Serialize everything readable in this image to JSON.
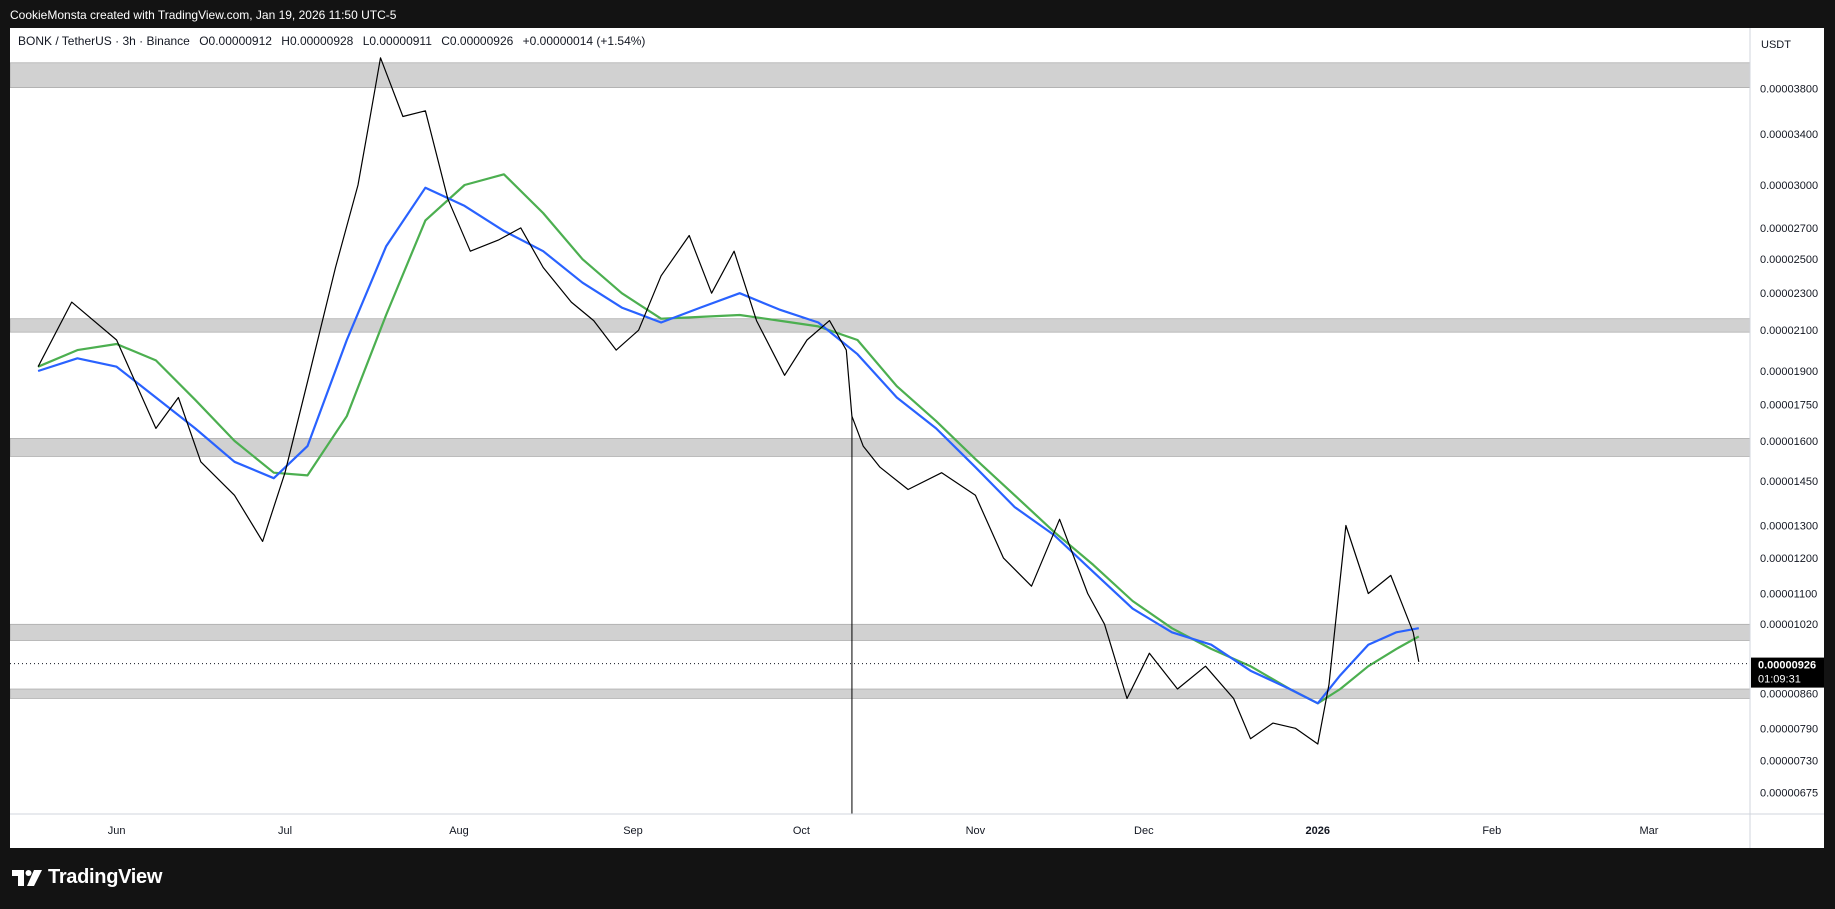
{
  "header": {
    "attribution": "CookieMonsta created with TradingView.com, Jan 19, 2026 11:50 UTC-5"
  },
  "brand": {
    "logo_text": "TradingView"
  },
  "chart_data": {
    "type": "line",
    "symbol_line": "BONK / TetherUS · 3h · Binance",
    "ohlc": {
      "open": "O0.00000912",
      "high": "H0.00000928",
      "low": "L0.00000911",
      "close": "C0.00000926",
      "change": "+0.00000014 (+1.54%)"
    },
    "currency": "USDT",
    "y_scale": "log",
    "y_ticks": [
      "0.00003800",
      "0.00003400",
      "0.00003000",
      "0.00002700",
      "0.00002500",
      "0.00002300",
      "0.00002100",
      "0.00001900",
      "0.00001750",
      "0.00001600",
      "0.00001450",
      "0.00001300",
      "0.00001200",
      "0.00001100",
      "0.00001020",
      "0.00000860",
      "0.00000790",
      "0.00000730",
      "0.00000675"
    ],
    "x_ticks": [
      "Jun",
      "Jul",
      "Aug",
      "Sep",
      "Oct",
      "Nov",
      "Dec",
      "2026",
      "Feb",
      "Mar"
    ],
    "current_price": "0.00000926",
    "countdown": "01:09:31",
    "zones": [
      {
        "low": 3.81e-05,
        "high": 4.05e-05
      },
      {
        "low": 2.09e-05,
        "high": 2.16e-05
      },
      {
        "low": 1.54e-05,
        "high": 1.61e-05
      },
      {
        "low": 9.8e-06,
        "high": 1.02e-05
      },
      {
        "low": 8.5e-06,
        "high": 8.7e-06
      }
    ],
    "series": [
      {
        "color": "#000000",
        "x": [
          "May 18",
          "May 24",
          "Jun 1",
          "Jun 8",
          "Jun 12",
          "Jun 16",
          "Jun 22",
          "Jun 27",
          "Jul 1",
          "Jul 5",
          "Jul 10",
          "Jul 14",
          "Jul 16",
          "Jul 18",
          "Jul 22",
          "Jul 26",
          "Jul 30",
          "Aug 3",
          "Aug 8",
          "Aug 12",
          "Aug 16",
          "Aug 21",
          "Aug 25",
          "Aug 29",
          "Sep 2",
          "Sep 6",
          "Sep 11",
          "Sep 15",
          "Sep 19",
          "Sep 23",
          "Sep 28",
          "Oct 2",
          "Oct 6",
          "Oct 9",
          "Oct 10",
          "Oct 12",
          "Oct 15",
          "Oct 20",
          "Oct 26",
          "Nov 1",
          "Nov 6",
          "Nov 11",
          "Nov 16",
          "Nov 21",
          "Nov 24",
          "Nov 28",
          "Dec 2",
          "Dec 7",
          "Dec 12",
          "Dec 17",
          "Dec 20",
          "Dec 24",
          "Dec 28",
          "Jan 1",
          "Jan 3",
          "Jan 6",
          "Jan 10",
          "Jan 14",
          "Jan 18",
          "Jan 19"
        ],
        "values": [
          1.92e-05,
          2.25e-05,
          2.05e-05,
          1.65e-05,
          1.78e-05,
          1.52e-05,
          1.4e-05,
          1.25e-05,
          1.48e-05,
          1.85e-05,
          2.45e-05,
          3e-05,
          3.5e-05,
          4.1e-05,
          3.55e-05,
          3.6e-05,
          2.9e-05,
          2.55e-05,
          2.62e-05,
          2.7e-05,
          2.45e-05,
          2.25e-05,
          2.15e-05,
          2e-05,
          2.1e-05,
          2.4e-05,
          2.65e-05,
          2.3e-05,
          2.55e-05,
          2.15e-05,
          1.88e-05,
          2.05e-05,
          2.15e-05,
          2e-05,
          1.7e-05,
          1.58e-05,
          1.5e-05,
          1.42e-05,
          1.48e-05,
          1.4e-05,
          1.2e-05,
          1.12e-05,
          1.32e-05,
          1.1e-05,
          1.02e-05,
          8.5e-06,
          9.5e-06,
          8.7e-06,
          9.2e-06,
          8.5e-06,
          7.7e-06,
          8e-06,
          7.9e-06,
          7.6e-06,
          8.8e-06,
          1.3e-05,
          1.1e-05,
          1.15e-05,
          1e-05,
          9.3e-06
        ]
      },
      {
        "color": "#2962ff",
        "x": [
          "May 18",
          "May 25",
          "Jun 1",
          "Jun 8",
          "Jun 15",
          "Jun 22",
          "Jun 29",
          "Jul 5",
          "Jul 12",
          "Jul 19",
          "Jul 26",
          "Aug 2",
          "Aug 9",
          "Aug 16",
          "Aug 23",
          "Aug 30",
          "Sep 6",
          "Sep 13",
          "Sep 20",
          "Sep 27",
          "Oct 4",
          "Oct 11",
          "Oct 18",
          "Oct 25",
          "Nov 1",
          "Nov 8",
          "Nov 15",
          "Nov 22",
          "Nov 29",
          "Dec 6",
          "Dec 13",
          "Dec 20",
          "Dec 27",
          "Jan 1",
          "Jan 5",
          "Jan 10",
          "Jan 15",
          "Jan 19"
        ],
        "values": [
          1.9e-05,
          1.96e-05,
          1.92e-05,
          1.78e-05,
          1.65e-05,
          1.52e-05,
          1.46e-05,
          1.58e-05,
          2.05e-05,
          2.58e-05,
          2.98e-05,
          2.85e-05,
          2.68e-05,
          2.55e-05,
          2.36e-05,
          2.22e-05,
          2.14e-05,
          2.22e-05,
          2.3e-05,
          2.21e-05,
          2.14e-05,
          1.98e-05,
          1.78e-05,
          1.65e-05,
          1.5e-05,
          1.36e-05,
          1.27e-05,
          1.16e-05,
          1.06e-05,
          1e-05,
          9.7e-06,
          9.1e-06,
          8.7e-06,
          8.4e-06,
          9e-06,
          9.7e-06,
          1e-05,
          1.01e-05
        ]
      },
      {
        "color": "#4caf50",
        "x": [
          "May 18",
          "May 25",
          "Jun 1",
          "Jun 8",
          "Jun 15",
          "Jun 22",
          "Jun 29",
          "Jul 5",
          "Jul 12",
          "Jul 19",
          "Jul 26",
          "Aug 2",
          "Aug 9",
          "Aug 16",
          "Aug 23",
          "Aug 30",
          "Sep 6",
          "Sep 13",
          "Sep 20",
          "Sep 27",
          "Oct 4",
          "Oct 11",
          "Oct 18",
          "Oct 25",
          "Nov 1",
          "Nov 8",
          "Nov 15",
          "Nov 22",
          "Nov 29",
          "Dec 6",
          "Dec 13",
          "Dec 20",
          "Dec 27",
          "Jan 1",
          "Jan 5",
          "Jan 10",
          "Jan 15",
          "Jan 19"
        ],
        "values": [
          1.92e-05,
          2e-05,
          2.03e-05,
          1.95e-05,
          1.77e-05,
          1.6e-05,
          1.48e-05,
          1.47e-05,
          1.7e-05,
          2.18e-05,
          2.75e-05,
          3e-05,
          3.08e-05,
          2.8e-05,
          2.5e-05,
          2.3e-05,
          2.16e-05,
          2.17e-05,
          2.18e-05,
          2.15e-05,
          2.12e-05,
          2.05e-05,
          1.83e-05,
          1.68e-05,
          1.53e-05,
          1.4e-05,
          1.28e-05,
          1.18e-05,
          1.08e-05,
          1.01e-05,
          9.6e-06,
          9.2e-06,
          8.7e-06,
          8.4e-06,
          8.7e-06,
          9.2e-06,
          9.6e-06,
          9.9e-06
        ]
      }
    ]
  }
}
